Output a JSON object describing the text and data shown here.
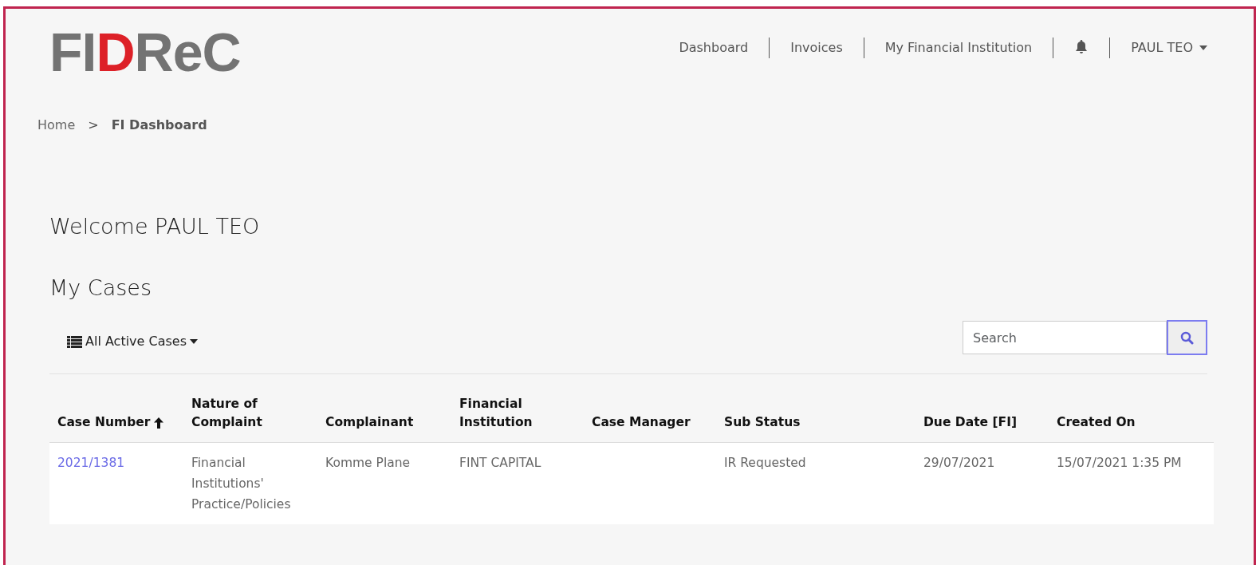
{
  "logo": {
    "parts": [
      {
        "text": "FI",
        "color": "#737373"
      },
      {
        "text": "D",
        "color": "#dd2027"
      },
      {
        "text": "ReC",
        "color": "#737373"
      }
    ]
  },
  "nav": {
    "items": [
      {
        "label": "Dashboard",
        "kind": "link"
      },
      {
        "label": "Invoices",
        "kind": "link"
      },
      {
        "label": "My Financial Institution",
        "kind": "link"
      },
      {
        "kind": "bell"
      },
      {
        "label": "PAUL TEO",
        "kind": "user"
      }
    ]
  },
  "breadcrumb": [
    {
      "label": "Home",
      "kind": "link"
    },
    {
      "label": ">",
      "kind": "separator"
    },
    {
      "label": "FI Dashboard",
      "kind": "current"
    }
  ],
  "welcome": "Welcome PAUL TEO",
  "section_title": "My Cases",
  "filter": {
    "label": "All Active Cases"
  },
  "search": {
    "placeholder": "Search"
  },
  "table": {
    "columns": [
      {
        "label": "Case Number",
        "sorted": true
      },
      {
        "label": "Nature of Complaint",
        "sorted": false
      },
      {
        "label": "Complainant",
        "sorted": false
      },
      {
        "label": "Financial Institution",
        "sorted": false
      },
      {
        "label": "Case Manager",
        "sorted": false
      },
      {
        "label": "Sub Status",
        "sorted": false
      },
      {
        "label": "Due Date [FI]",
        "sorted": false
      },
      {
        "label": "Created On",
        "sorted": false
      }
    ],
    "rows": [
      {
        "cells": [
          "2021/1381",
          "Financial Institutions' Practice/Policies",
          "Komme Plane",
          "FINT CAPITAL",
          "",
          "IR Requested",
          "29/07/2021",
          "15/07/2021 1:35 PM"
        ]
      }
    ]
  }
}
